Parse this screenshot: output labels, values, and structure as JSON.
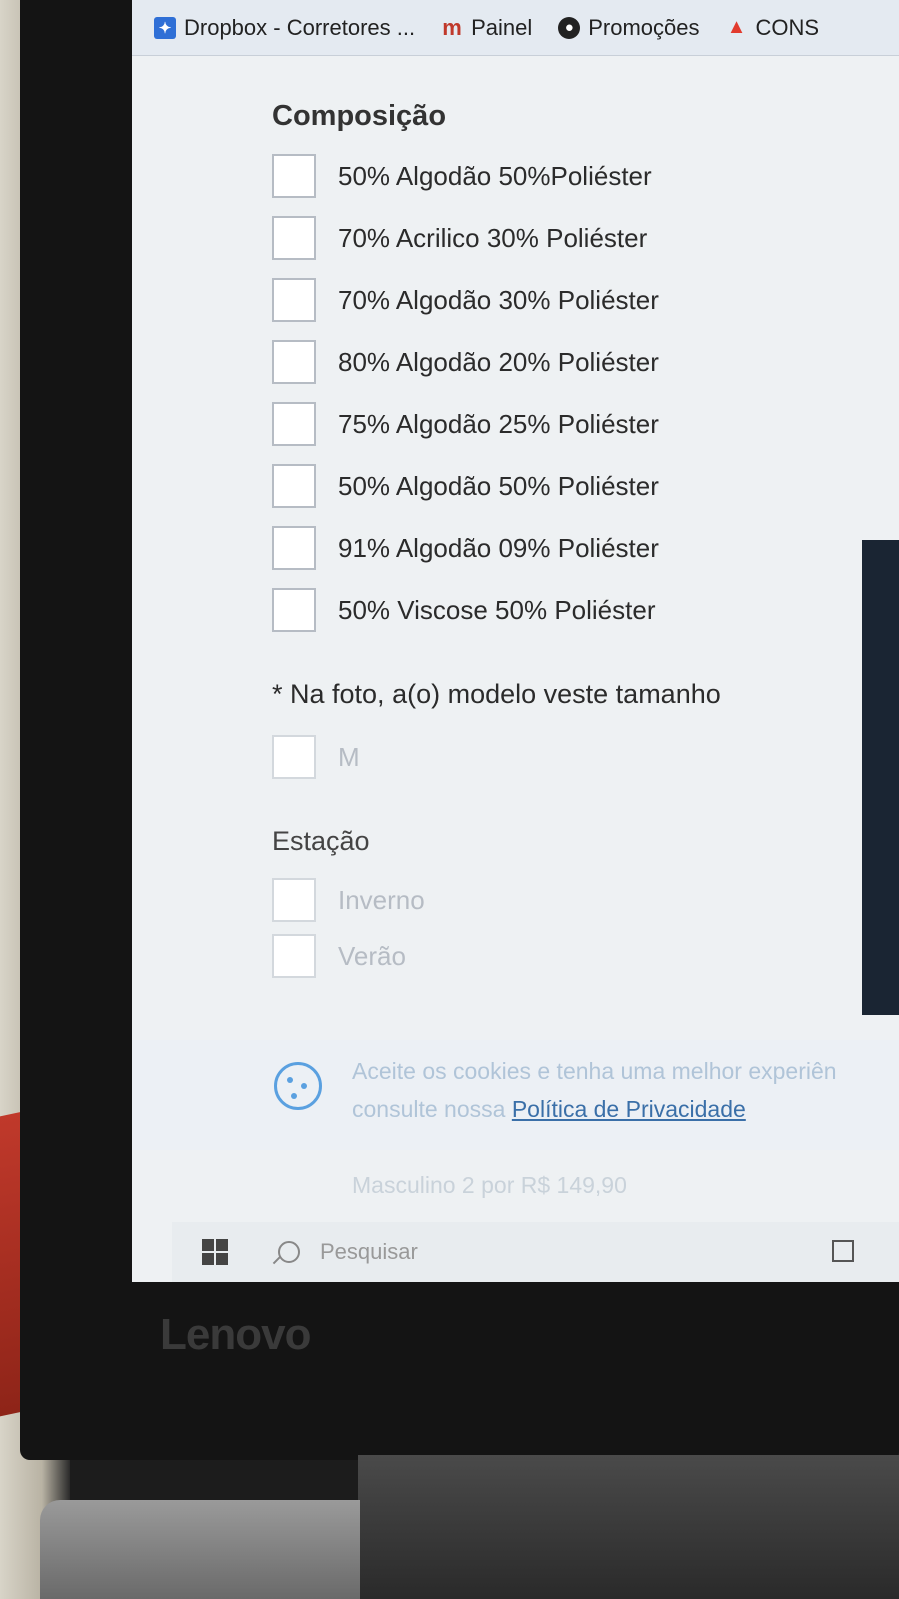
{
  "bookmarks": [
    {
      "label": "Dropbox - Corretores ...",
      "icon": "dropbox-icon"
    },
    {
      "label": "Painel",
      "icon": "painel-icon"
    },
    {
      "label": "Promoções",
      "icon": "promocoes-icon"
    },
    {
      "label": "CONS",
      "icon": "cons-icon"
    }
  ],
  "composition": {
    "title": "Composição",
    "options": [
      "50% Algodão 50%Poliéster",
      "70% Acrilico 30% Poliéster",
      "70% Algodão 30% Poliéster",
      "80% Algodão 20% Poliéster",
      "75% Algodão 25% Poliéster",
      "50% Algodão 50% Poliéster",
      "91% Algodão 09% Poliéster",
      "50% Viscose 50% Poliéster"
    ]
  },
  "size": {
    "title": "* Na foto, a(o) modelo veste tamanho",
    "options": [
      "M"
    ]
  },
  "season": {
    "title": "Estação",
    "options": [
      "Inverno",
      "Verão"
    ]
  },
  "cookie": {
    "text_line1": "Aceite os cookies e tenha uma melhor experiên",
    "text_line2_prefix": "consulte nossa ",
    "link": "Política de Privacidade"
  },
  "promo": "Masculino 2 por R$ 149,90",
  "taskbar": {
    "search_placeholder": "Pesquisar"
  },
  "brand": "Lenovo"
}
